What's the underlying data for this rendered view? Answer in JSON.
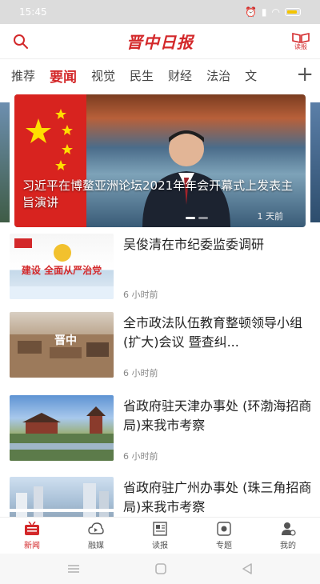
{
  "status": {
    "time": "15:45"
  },
  "header": {
    "brand": "晋中日报",
    "paper_label": "读报"
  },
  "tabs": [
    {
      "label": "推荐",
      "active": false
    },
    {
      "label": "要闻",
      "active": true
    },
    {
      "label": "视觉",
      "active": false
    },
    {
      "label": "民生",
      "active": false
    },
    {
      "label": "财经",
      "active": false
    },
    {
      "label": "法治",
      "active": false
    },
    {
      "label": "文",
      "active": false
    }
  ],
  "tabs_plus_icon": "plus-icon",
  "banner": {
    "caption": "习近平在博鳌亚洲论坛2021年年会开幕式上发表主旨演讲",
    "time": "1 天前"
  },
  "news": [
    {
      "title": "吴俊清在市纪委监委调研",
      "time": "6 小时前",
      "thumb_text": "建设 全面从严治党",
      "thumb_text_color": "#d3282a"
    },
    {
      "title": "全市政法队伍教育整顿领导小组 (扩大)会议 暨查纠...",
      "time": "6 小时前",
      "thumb_text": "晋中",
      "thumb_text_color": "#ffffff"
    },
    {
      "title": "省政府驻天津办事处 (环渤海招商局)来我市考察",
      "time": "6 小时前"
    },
    {
      "title": "省政府驻广州办事处 (珠三角招商局)来我市考察",
      "time": ""
    }
  ],
  "bottom_nav": [
    {
      "label": "新闻",
      "icon": "tv-icon",
      "active": true
    },
    {
      "label": "融媒",
      "icon": "cloud-icon",
      "active": false
    },
    {
      "label": "读报",
      "icon": "newspaper-icon",
      "active": false
    },
    {
      "label": "专题",
      "icon": "badge-icon",
      "active": false
    },
    {
      "label": "我的",
      "icon": "user-icon",
      "active": false
    }
  ],
  "colors": {
    "accent": "#d3282a",
    "text": "#222222",
    "muted": "#888888"
  }
}
